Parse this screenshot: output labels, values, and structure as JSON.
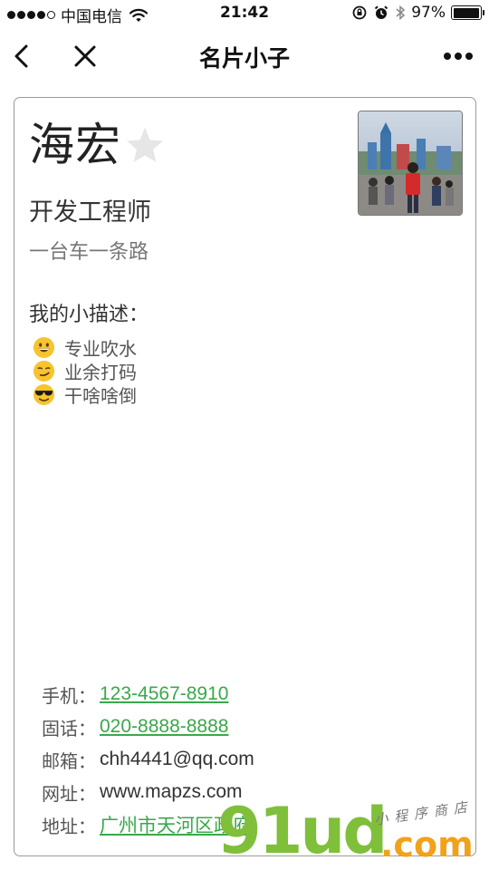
{
  "status_bar": {
    "carrier": "中国电信",
    "time": "21:42",
    "battery": "97%",
    "battery_level": 0.97
  },
  "nav": {
    "title": "名片小子"
  },
  "card": {
    "name": "海宏",
    "job_title": "开发工程师",
    "motto": "一台车一条路",
    "description_label": "我的小描述：",
    "descriptions": [
      {
        "icon": "grinning-face-icon",
        "text": "专业吹水"
      },
      {
        "icon": "smirking-face-icon",
        "text": "业余打码"
      },
      {
        "icon": "sunglasses-face-icon",
        "text": "干啥啥倒"
      }
    ],
    "contacts": {
      "mobile": {
        "label": "手机：",
        "value": "123-4567-8910"
      },
      "phone": {
        "label": "固话：",
        "value": "020-8888-8888"
      },
      "email": {
        "label": "邮箱：",
        "value": "chh4441@qq.com"
      },
      "website": {
        "label": "网址：",
        "value": "www.mapzs.com"
      },
      "address": {
        "label": "地址：",
        "value": "广州市天河区政府"
      }
    }
  },
  "watermark": {
    "brand": "91ud",
    "suffix": ".com",
    "tagline": "小程序商店"
  },
  "colors": {
    "link": "#3aa84a",
    "watermark_green": "#7fbf3a",
    "watermark_orange": "#f2a11a"
  }
}
